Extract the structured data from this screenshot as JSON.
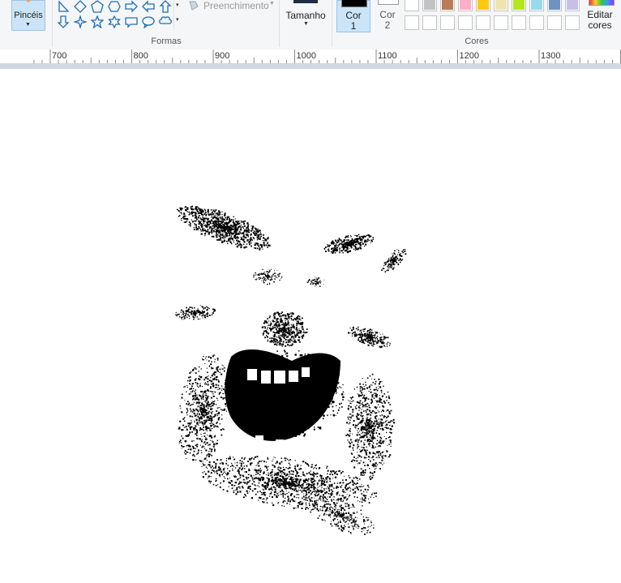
{
  "ribbon": {
    "brushes_label": "Pincéis",
    "shapes_group_label": "Formas",
    "fill_label": "Preenchimento",
    "size_label": "Tamanho",
    "color1_label_line1": "Cor",
    "color1_label_line2": "1",
    "color2_label_line1": "Cor",
    "color2_label_line2": "2",
    "colors_group_label": "Cores",
    "edit_colors_line1": "Editar",
    "edit_colors_line2": "cores",
    "palette_row1": [
      "#ffffff",
      "#c3c3c3",
      "#b97a57",
      "#ffaec9",
      "#ffc90e",
      "#efe4b0",
      "#b5e61d",
      "#99d9ea",
      "#7092be",
      "#c8bfe7"
    ],
    "palette_row2": [
      "#ffffff",
      "#ffffff",
      "#ffffff",
      "#ffffff",
      "#ffffff",
      "#ffffff",
      "#ffffff",
      "#ffffff",
      "#ffffff",
      "#ffffff"
    ],
    "color1_value": "#000000",
    "color2_value": "#ffffff"
  },
  "ruler": {
    "labels": [
      "700",
      "800",
      "900",
      "1000",
      "1100",
      "1200",
      "1300"
    ]
  }
}
